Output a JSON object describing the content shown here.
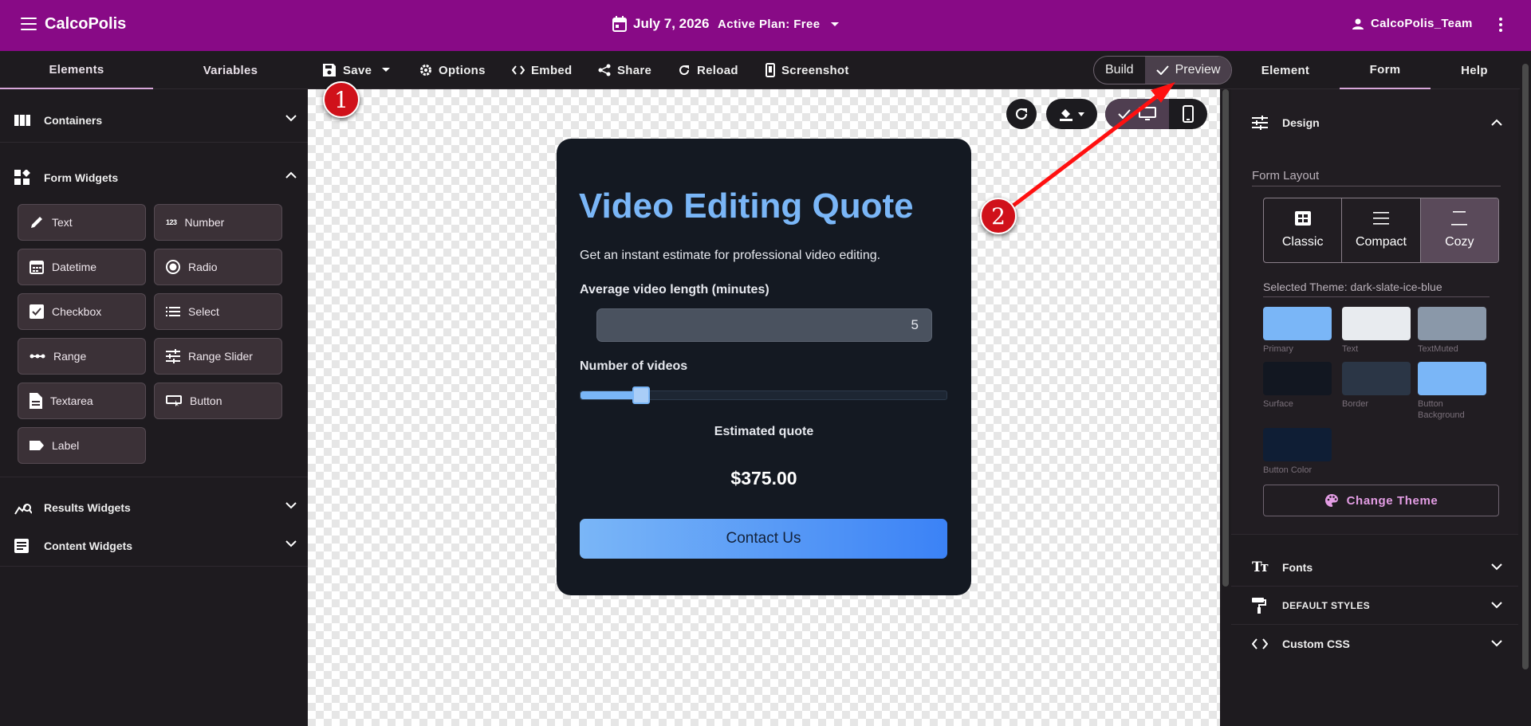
{
  "app": {
    "title": "CalcoPolis",
    "date": "July 7, 2026",
    "plan": "Active Plan: Free",
    "user": "CalcoPolis_Team"
  },
  "left_tabs": [
    "Elements",
    "Variables"
  ],
  "toolbar": {
    "save": "Save",
    "options": "Options",
    "embed": "Embed",
    "share": "Share",
    "reload": "Reload",
    "screenshot": "Screenshot"
  },
  "mode": {
    "build": "Build",
    "preview": "Preview",
    "selected": "Preview"
  },
  "right_tabs": [
    "Element",
    "Form",
    "Help"
  ],
  "left_sections": {
    "containers": "Containers",
    "form_widgets": "Form Widgets",
    "results_widgets": "Results Widgets",
    "content_widgets": "Content Widgets"
  },
  "widgets": [
    "Text",
    "Number",
    "Datetime",
    "Radio",
    "Checkbox",
    "Select",
    "Range",
    "Range Slider",
    "Textarea",
    "Button",
    "Label"
  ],
  "form": {
    "title": "Video Editing Quote",
    "subtitle": "Get an instant estimate for professional video editing.",
    "field1_label": "Average video length (minutes)",
    "field1_value": "5",
    "field2_label": "Number of videos",
    "slider_fraction": 0.165,
    "estimate_label": "Estimated quote",
    "estimate_value": "$375.00",
    "button": "Contact Us"
  },
  "design": {
    "header": "Design",
    "layout_label": "Form Layout",
    "layouts": [
      "Classic",
      "Compact",
      "Cozy"
    ],
    "selected_layout": "Cozy",
    "theme_label": "Selected Theme: dark-slate-ice-blue",
    "swatches": [
      {
        "label": "Primary",
        "color": "#7ab6f7"
      },
      {
        "label": "Text",
        "color": "#e8ebef"
      },
      {
        "label": "TextMuted",
        "color": "#8a98a9"
      },
      {
        "label": "Surface",
        "color": "#121721"
      },
      {
        "label": "Border",
        "color": "#2b3646"
      },
      {
        "label": "Button Background",
        "color": "#7ab6f7"
      },
      {
        "label": "Button Color",
        "color": "#0f1e35"
      }
    ],
    "change_theme": "Change Theme"
  },
  "right_sections": {
    "fonts": "Fonts",
    "default_styles": "DEFAULT STYLES",
    "custom_css": "Custom CSS"
  },
  "annotations": [
    "1",
    "2"
  ],
  "colors": {
    "brand": "#880a86",
    "accent": "#d7a6d9",
    "marker": "#d0111a"
  }
}
